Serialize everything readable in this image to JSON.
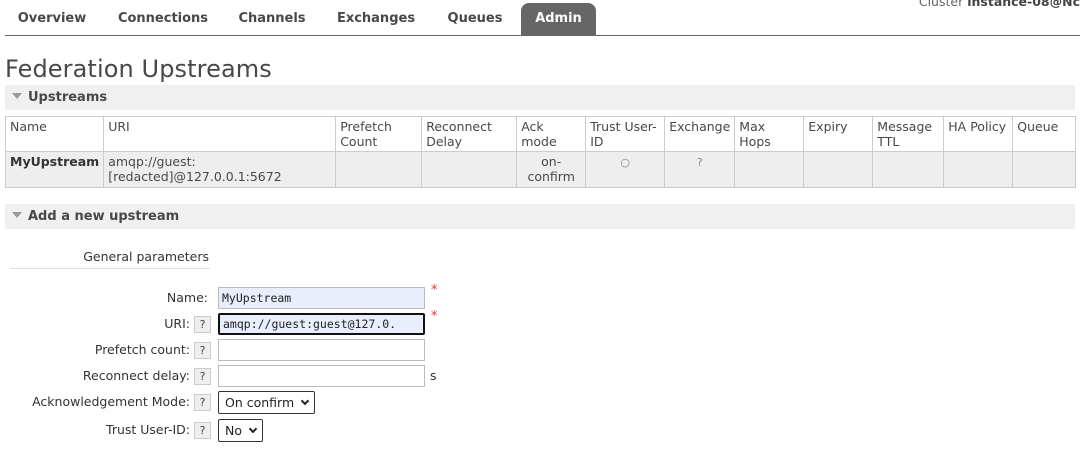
{
  "header": {
    "cluster_label": "Cluster",
    "cluster_name": "instance-08@Nc"
  },
  "nav": {
    "tabs": [
      {
        "label": "Overview"
      },
      {
        "label": "Connections"
      },
      {
        "label": "Channels"
      },
      {
        "label": "Exchanges"
      },
      {
        "label": "Queues"
      },
      {
        "label": "Admin",
        "active": true
      }
    ]
  },
  "page": {
    "title": "Federation Upstreams"
  },
  "upstreams_section": {
    "title": "Upstreams",
    "columns": [
      "Name",
      "URI",
      "Prefetch Count",
      "Reconnect Delay",
      "Ack mode",
      "Trust User-ID",
      "Exchange",
      "Max Hops",
      "Expiry",
      "Message TTL",
      "HA Policy",
      "Queue"
    ],
    "rows": [
      {
        "name": "MyUpstream",
        "uri": "amqp://guest:[redacted]@127.0.0.1:5672",
        "prefetch_count": "",
        "reconnect_delay": "",
        "ack_mode": "on-confirm",
        "trust_user_id": "○",
        "exchange": "?",
        "max_hops": "",
        "expiry": "",
        "message_ttl": "",
        "ha_policy": "",
        "queue": ""
      }
    ]
  },
  "add_section": {
    "title": "Add a new upstream",
    "group_label": "General parameters",
    "fields": {
      "name": {
        "label": "Name:",
        "value": "MyUpstream",
        "required_mark": "*"
      },
      "uri": {
        "label": "URI:",
        "value": "amqp://guest:guest@127.0.",
        "required_mark": "*",
        "help": "?"
      },
      "prefetch": {
        "label": "Prefetch count:",
        "value": "",
        "help": "?"
      },
      "reconnect": {
        "label": "Reconnect delay:",
        "value": "",
        "help": "?",
        "unit": "s"
      },
      "ack_mode": {
        "label": "Acknowledgement Mode:",
        "selected": "On confirm",
        "help": "?"
      },
      "trust_user_id": {
        "label": "Trust User-ID:",
        "selected": "No",
        "help": "?"
      }
    }
  }
}
